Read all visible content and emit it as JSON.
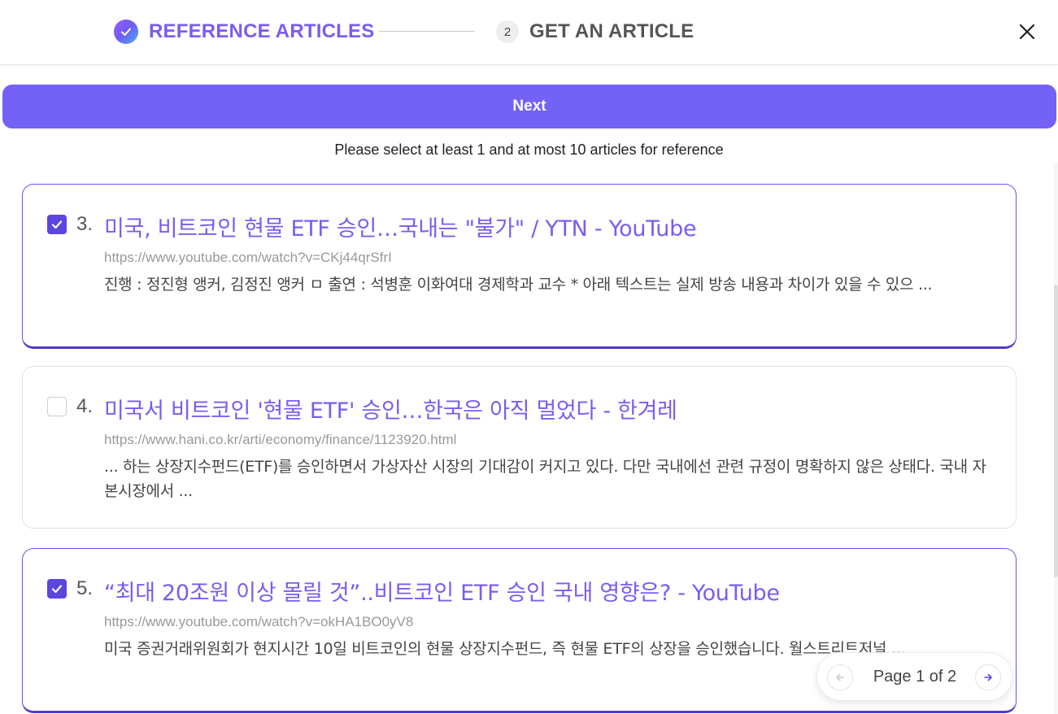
{
  "stepper": {
    "step1": {
      "label": "REFERENCE ARTICLES",
      "state": "done"
    },
    "step2": {
      "number": "2",
      "label": "GET AN ARTICLE",
      "state": "upcoming"
    }
  },
  "actions": {
    "next_label": "Next"
  },
  "instruction": "Please select at least 1 and at most 10 articles for reference",
  "articles": [
    {
      "index": "3.",
      "title": "미국, 비트코인 현물 ETF 승인…국내는 \"불가\" / YTN - YouTube",
      "url": "https://www.youtube.com/watch?v=CKj44qrSfrI",
      "snippet": "진행 : 정진형 앵커, 김정진 앵커 ㅁ 출연 : 석병훈 이화여대 경제학과 교수 * 아래 텍스트는 실제 방송 내용과 차이가 있을 수 있으 ...",
      "selected": true
    },
    {
      "index": "4.",
      "title": "미국서 비트코인 '현물 ETF' 승인…한국은 아직 멀었다 - 한겨레",
      "url": "https://www.hani.co.kr/arti/economy/finance/1123920.html",
      "snippet": "... 하는 상장지수펀드(ETF)를 승인하면서 가상자산 시장의 기대감이 커지고 있다. 다만 국내에선 관련 규정이 명확하지 않은 상태다. 국내 자본시장에서 ...",
      "selected": false
    },
    {
      "index": "5.",
      "title": "“최대 20조원 이상 몰릴 것”..비트코인 ETF 승인 국내 영향은? - YouTube",
      "url": "https://www.youtube.com/watch?v=okHA1BO0yV8",
      "snippet": "미국 증권거래위원회가 현지시간 10일 비트코인의 현물 상장지수펀드, 즉 현물 ETF의 상장을 승인했습니다. 월스트리트저널 ...",
      "selected": true
    }
  ],
  "pagination": {
    "label": "Page 1 of 2",
    "current": 1,
    "total": 2
  },
  "colors": {
    "accent": "#7461f5",
    "title": "#7b5cf0",
    "checkbox": "#5b46e0"
  },
  "icons": {
    "step1": "check-circle-icon",
    "close": "close-icon",
    "prev": "arrow-left-icon",
    "next": "arrow-right-icon"
  }
}
